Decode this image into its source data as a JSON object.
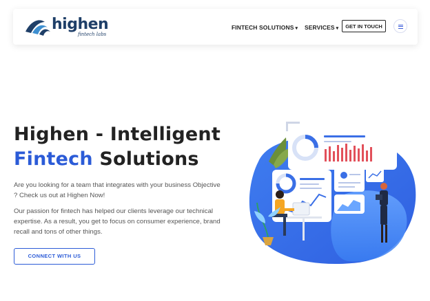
{
  "brand": {
    "name": "highen",
    "tagline": "fintech labs",
    "primary_color": "#1f3f68",
    "accent_color": "#2b5bd7"
  },
  "nav": {
    "items": [
      {
        "label": "FINTECH SOLUTIONS",
        "icon": "chevron-down-icon"
      },
      {
        "label": "SERVICES",
        "icon": "chevron-down-icon"
      }
    ],
    "cta_label": "GET IN TOUCH",
    "menu_icon": "hamburger-icon"
  },
  "hero": {
    "title_line1": "Highen - Intelligent",
    "title_accent": "Fintech",
    "title_rest": " Solutions",
    "paragraph1": "Are you looking for a team that integrates with your business Objective ? Check us out at Highen Now!",
    "paragraph2": "Our passion for fintech has helped our clients leverage our technical expertise. As a result, you get to focus on consumer experience, brand recall and tons of other things.",
    "cta_label": "CONNECT WITH US"
  }
}
